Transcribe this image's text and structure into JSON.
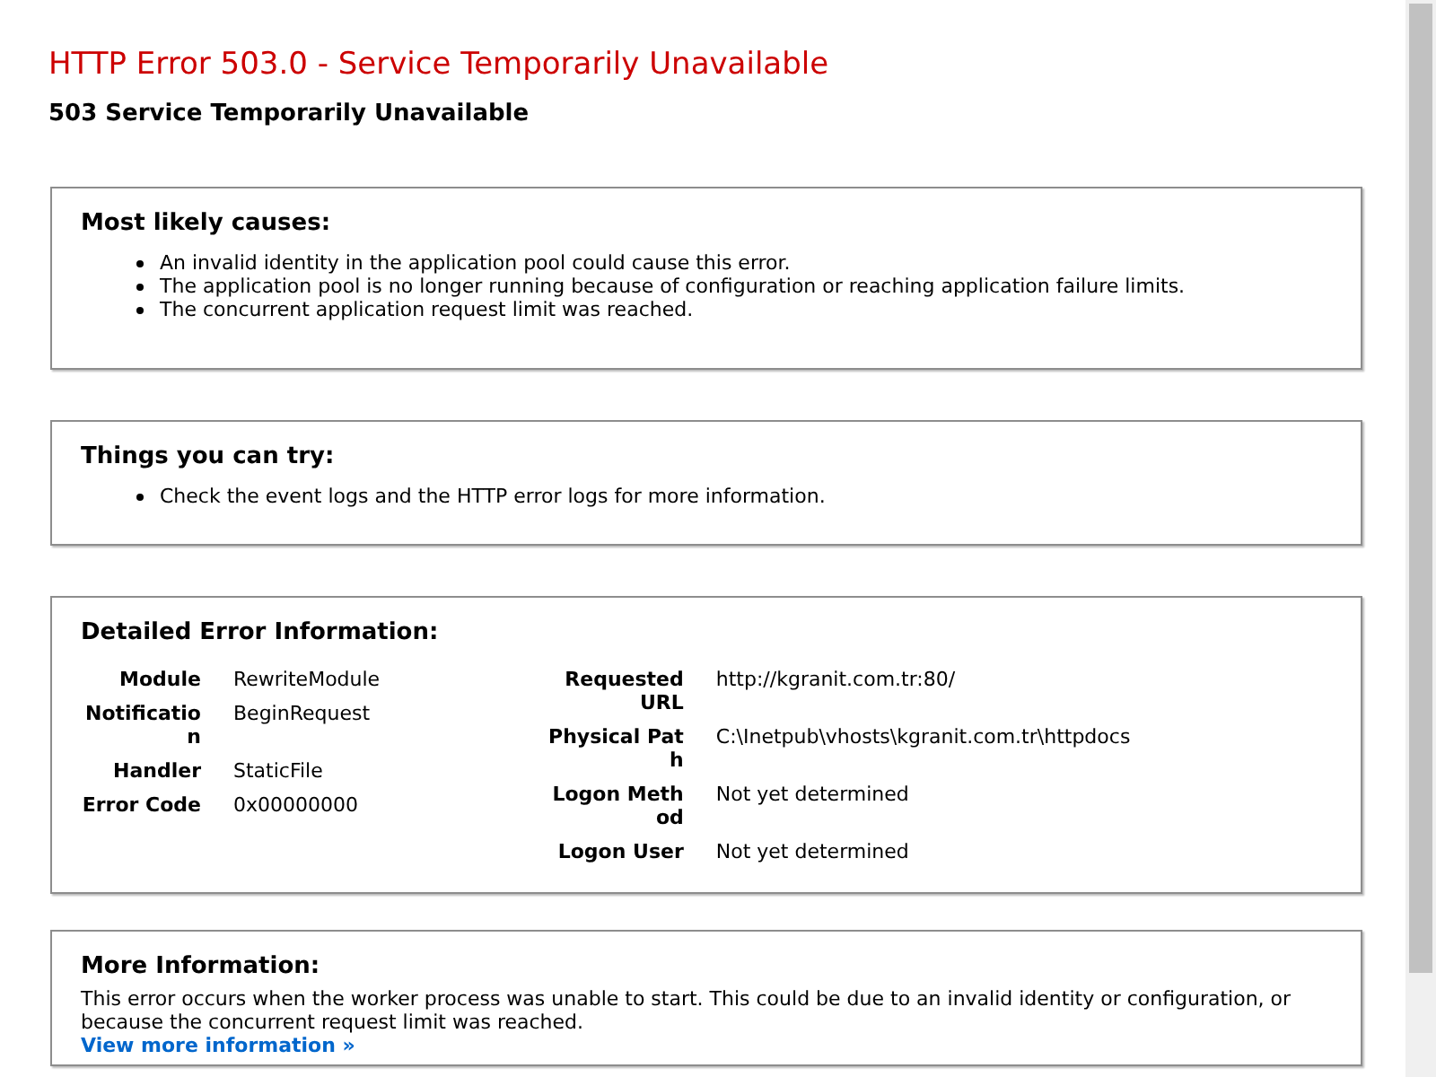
{
  "title": "HTTP Error 503.0 - Service Temporarily Unavailable",
  "subtitle": "503 Service Temporarily Unavailable",
  "causes": {
    "heading": "Most likely causes:",
    "items": [
      "An invalid identity in the application pool could cause this error.",
      "The application pool is no longer running because of configuration or reaching application failure limits.",
      "The concurrent application request limit was reached."
    ]
  },
  "things_to_try": {
    "heading": "Things you can try:",
    "items": [
      "Check the event logs and the HTTP error logs for more information."
    ]
  },
  "details": {
    "heading": "Detailed Error Information:",
    "left": [
      {
        "label": "Module",
        "value": "RewriteModule"
      },
      {
        "label": "Notification",
        "value": "BeginRequest"
      },
      {
        "label": "Handler",
        "value": "StaticFile"
      },
      {
        "label": "Error Code",
        "value": "0x00000000"
      }
    ],
    "right": [
      {
        "label": "Requested URL",
        "value": "http://kgranit.com.tr:80/"
      },
      {
        "label": "Physical Path",
        "value": "C:\\Inetpub\\vhosts\\kgranit.com.tr\\httpdocs"
      },
      {
        "label": "Logon Method",
        "value": "Not yet determined"
      },
      {
        "label": "Logon User",
        "value": "Not yet determined"
      }
    ]
  },
  "more_info": {
    "heading": "More Information:",
    "text": "This error occurs when the worker process was unable to start. This could be due to an invalid identity or configuration, or because the concurrent request limit was reached.",
    "link": "View more information »"
  }
}
